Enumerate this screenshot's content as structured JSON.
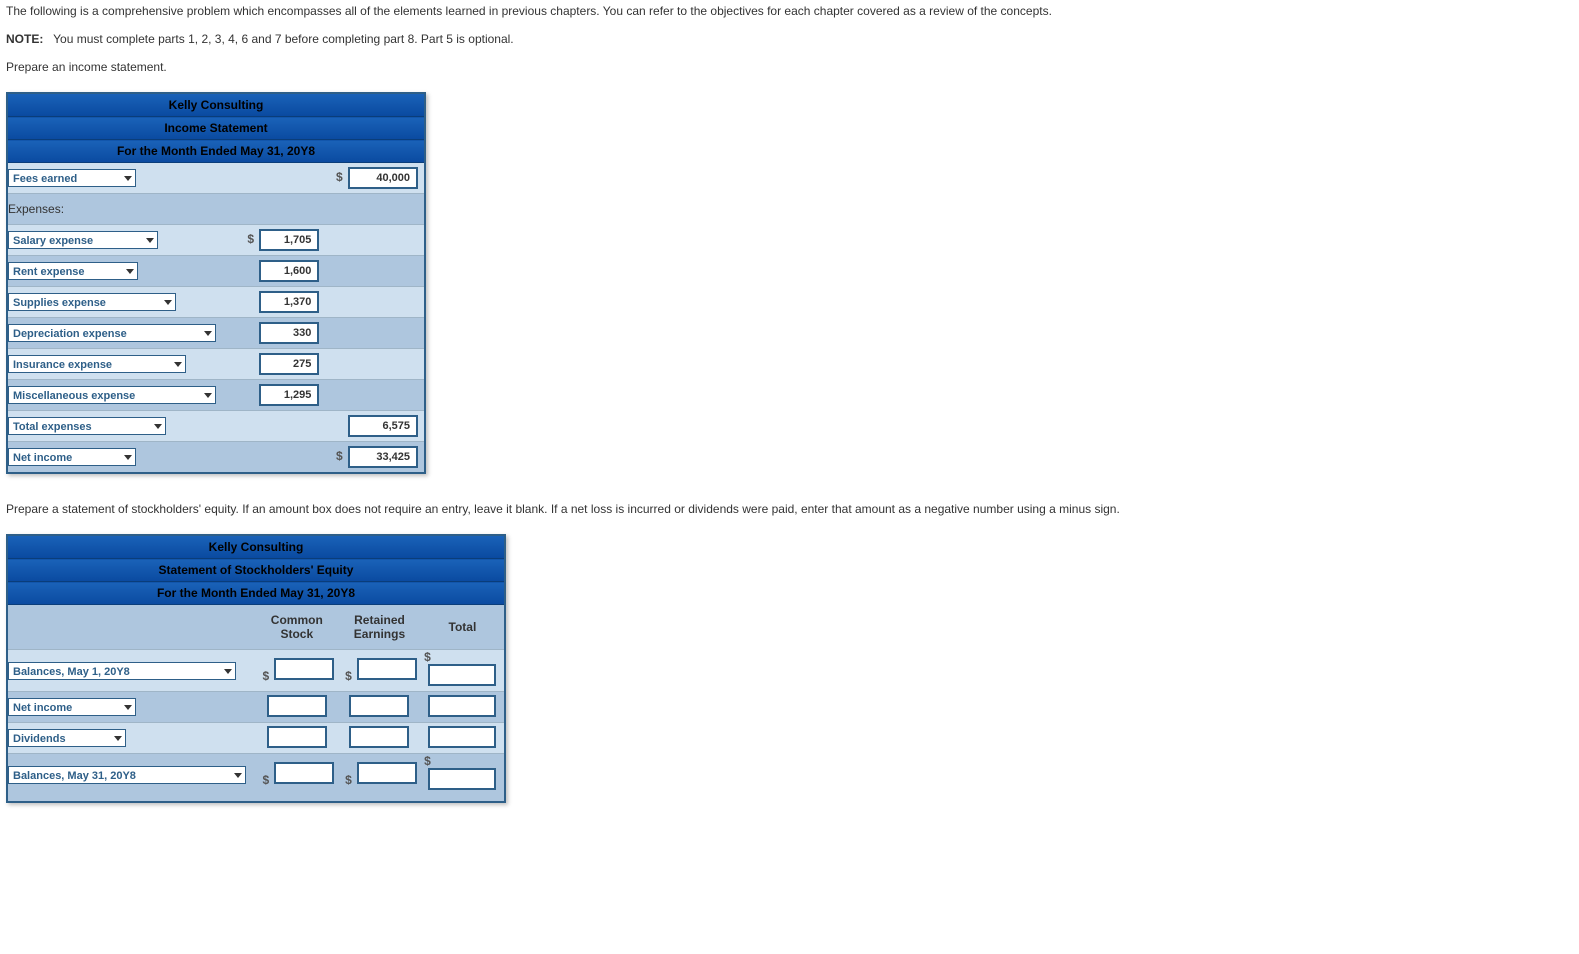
{
  "text": {
    "intro": "The following is a comprehensive problem which encompasses all of the elements learned in previous chapters. You can refer to the objectives for each chapter covered as a review of the concepts.",
    "note_label": "NOTE:",
    "note_body": "You must complete parts 1, 2, 3, 4, 6 and 7 before completing part 8. Part 5 is optional.",
    "instr1": "Prepare an income statement.",
    "instr2": "Prepare a statement of stockholders' equity. If an amount box does not require an entry, leave it blank. If a net loss is incurred or dividends were paid, enter that amount as a negative number using a minus sign."
  },
  "tbl1": {
    "h1": "Kelly Consulting",
    "h2": "Income Statement",
    "h3": "For the Month Ended May 31, 20Y8",
    "rows": {
      "fees_label": "Fees earned",
      "fees_value": "40,000",
      "expenses_label": "Expenses:",
      "salary_label": "Salary expense",
      "salary_value": "1,705",
      "rent_label": "Rent expense",
      "rent_value": "1,600",
      "supplies_label": "Supplies expense",
      "supplies_value": "1,370",
      "dep_label": "Depreciation expense",
      "dep_value": "330",
      "ins_label": "Insurance expense",
      "ins_value": "275",
      "misc_label": "Miscellaneous expense",
      "misc_value": "1,295",
      "total_exp_label": "Total expenses",
      "total_exp_value": "6,575",
      "net_label": "Net income",
      "net_value": "33,425"
    }
  },
  "tbl2": {
    "h1": "Kelly Consulting",
    "h2": "Statement of Stockholders' Equity",
    "h3": "For the Month Ended May 31, 20Y8",
    "cols": {
      "c1a": "Common",
      "c1b": "Stock",
      "c2a": "Retained",
      "c2b": "Earnings",
      "c3": "Total"
    },
    "rows": {
      "bal1_label": "Balances, May 1, 20Y8",
      "net_label": "Net income",
      "div_label": "Dividends",
      "bal2_label": "Balances, May 31, 20Y8"
    }
  }
}
